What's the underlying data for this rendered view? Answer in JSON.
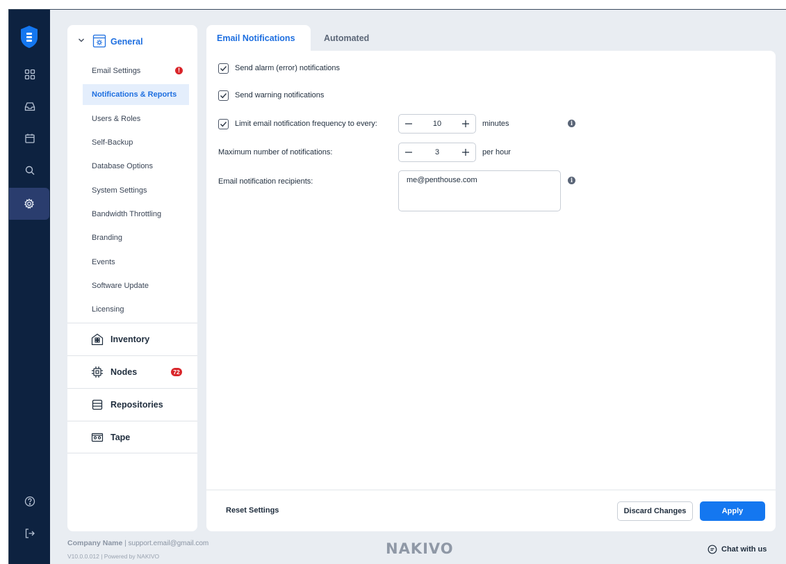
{
  "colors": {
    "rail": "#0d2240",
    "accent": "#1e6fe0",
    "apply": "#1477f0",
    "error": "#d9262b"
  },
  "rail": {
    "items": [
      {
        "name": "dashboard-icon"
      },
      {
        "name": "monitoring-icon"
      },
      {
        "name": "calendar-icon"
      },
      {
        "name": "search-icon"
      },
      {
        "name": "settings-icon",
        "active": true
      }
    ],
    "bottom": [
      {
        "name": "help-icon"
      },
      {
        "name": "logout-icon"
      }
    ]
  },
  "sidebar": {
    "group": "General",
    "items": [
      {
        "label": "Email Settings",
        "error": "!"
      },
      {
        "label": "Notifications & Reports",
        "active": true
      },
      {
        "label": "Users & Roles"
      },
      {
        "label": "Self-Backup"
      },
      {
        "label": "Database Options"
      },
      {
        "label": "System Settings"
      },
      {
        "label": "Bandwidth Throttling"
      },
      {
        "label": "Branding"
      },
      {
        "label": "Events"
      },
      {
        "label": "Software Update"
      },
      {
        "label": "Licensing"
      }
    ],
    "sections": [
      {
        "label": "Inventory"
      },
      {
        "label": "Nodes",
        "badge": "72"
      },
      {
        "label": "Repositories"
      },
      {
        "label": "Tape"
      }
    ]
  },
  "tabs": {
    "active": "Email Notifications",
    "inactive": "Automated Reports"
  },
  "form": {
    "alarm": {
      "label": "Send alarm (error) notifications",
      "checked": true
    },
    "warning": {
      "label": "Send warning notifications",
      "checked": true
    },
    "limit": {
      "label": "Limit email notification frequency to every:",
      "checked": true,
      "value": "10",
      "unit": "minutes"
    },
    "max": {
      "label": "Maximum number of notifications:",
      "value": "3",
      "unit": "per hour"
    },
    "recipients": {
      "label": "Email notification recipients:",
      "value": "me@penthouse.com"
    }
  },
  "actions": {
    "reset": "Reset Settings",
    "discard": "Discard Changes",
    "apply": "Apply"
  },
  "footer": {
    "company": "Company Name",
    "email": "| support.email@gmail.com",
    "version": "V10.0.0.012 | Powered by NAKIVO",
    "brand": "NAKIVO",
    "chat": "Chat with us"
  }
}
